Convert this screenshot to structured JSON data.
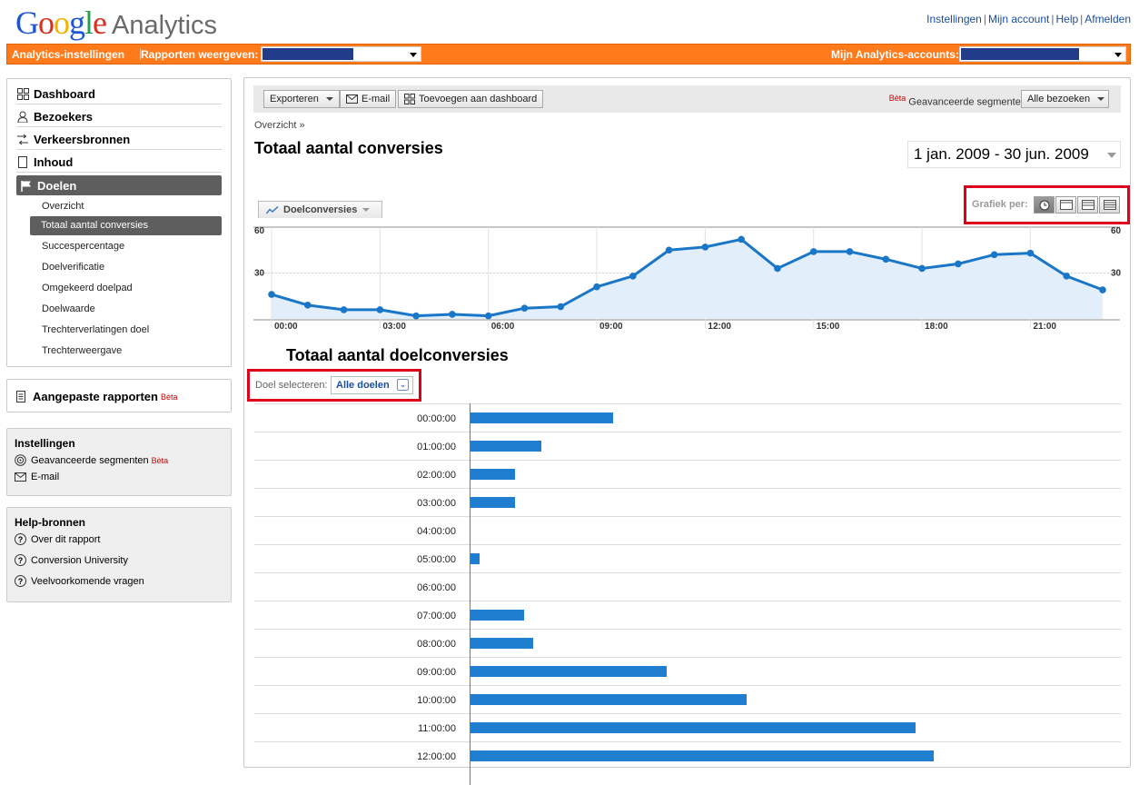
{
  "header": {
    "logo_google": "Google",
    "logo_product": "Analytics",
    "links": [
      "Instellingen",
      "Mijn account",
      "Help",
      "Afmelden"
    ]
  },
  "orange_bar": {
    "settings_label": "Analytics-instellingen",
    "reports_label": "Rapporten weergeven:",
    "accounts_label": "Mijn Analytics-accounts:"
  },
  "sidebar": {
    "nav": [
      {
        "label": "Dashboard",
        "icon": "dashboard-icon"
      },
      {
        "label": "Bezoekers",
        "icon": "person-icon"
      },
      {
        "label": "Verkeersbronnen",
        "icon": "traffic-icon"
      },
      {
        "label": "Inhoud",
        "icon": "document-icon"
      },
      {
        "label": "Doelen",
        "icon": "flag-icon",
        "active": true
      }
    ],
    "sub_items": [
      "Overzicht",
      "Totaal aantal conversies",
      "Succespercentage",
      "Doelverificatie",
      "Omgekeerd doelpad",
      "Doelwaarde",
      "Trechterverlatingen doel",
      "Trechterweergave"
    ],
    "custom_reports": {
      "label": "Aangepaste rapporten",
      "beta": "Bèta"
    },
    "settings": {
      "title": "Instellingen",
      "items": [
        {
          "label": "Geavanceerde segmenten",
          "beta": "Bèta",
          "icon": "segments-icon"
        },
        {
          "label": "E-mail",
          "icon": "envelope-icon"
        }
      ]
    },
    "help": {
      "title": "Help-bronnen",
      "items": [
        "Over dit rapport",
        "Conversion University",
        "Veelvoorkomende vragen"
      ]
    }
  },
  "toolbar": {
    "export_label": "Exporteren",
    "email_label": "E-mail",
    "dashboard_label": "Toevoegen aan dashboard",
    "beta": "Bèta",
    "segments_label": "Geavanceerde segmenten:",
    "segments_value": "Alle bezoeken"
  },
  "main": {
    "breadcrumb": "Overzicht »",
    "title": "Totaal aantal conversies",
    "date_range": "1 jan. 2009 - 30 jun. 2009",
    "graph_tab": "Doelconversies",
    "graph_per_label": "Grafiek per:",
    "table_title": "Totaal aantal doelconversies",
    "goal_select_label": "Doel selecteren:",
    "goal_select_value": "Alle doelen"
  },
  "chart_data": [
    {
      "type": "area",
      "series": [
        {
          "name": "Doelconversies",
          "values": [
            16,
            9,
            6,
            6,
            2,
            3,
            2,
            7,
            8,
            21,
            28,
            45,
            47,
            52,
            33,
            44,
            44,
            39,
            33,
            36,
            42,
            43,
            28,
            19
          ]
        }
      ],
      "x": [
        "00:00",
        "01:00",
        "02:00",
        "03:00",
        "04:00",
        "05:00",
        "06:00",
        "07:00",
        "08:00",
        "09:00",
        "10:00",
        "11:00",
        "12:00",
        "13:00",
        "14:00",
        "15:00",
        "16:00",
        "17:00",
        "18:00",
        "19:00",
        "20:00",
        "21:00",
        "22:00",
        "23:00"
      ],
      "x_tick_labels": [
        "00:00",
        "03:00",
        "06:00",
        "09:00",
        "12:00",
        "15:00",
        "18:00",
        "21:00"
      ],
      "y_tick_labels": [
        "60",
        "30"
      ],
      "ylim": [
        0,
        60
      ],
      "color": "#1a76c6",
      "fill_color": "#e2eef9"
    },
    {
      "type": "bar",
      "orientation": "horizontal",
      "categories": [
        "00:00:00",
        "01:00:00",
        "02:00:00",
        "03:00:00",
        "04:00:00",
        "05:00:00",
        "06:00:00",
        "07:00:00",
        "08:00:00",
        "09:00:00",
        "10:00:00",
        "11:00:00",
        "12:00:00"
      ],
      "values": [
        16,
        8,
        5,
        5,
        0,
        1,
        0,
        6,
        7,
        22,
        31,
        50,
        52
      ],
      "xlim": [
        0,
        73
      ],
      "color": "#1f7ed0"
    }
  ]
}
